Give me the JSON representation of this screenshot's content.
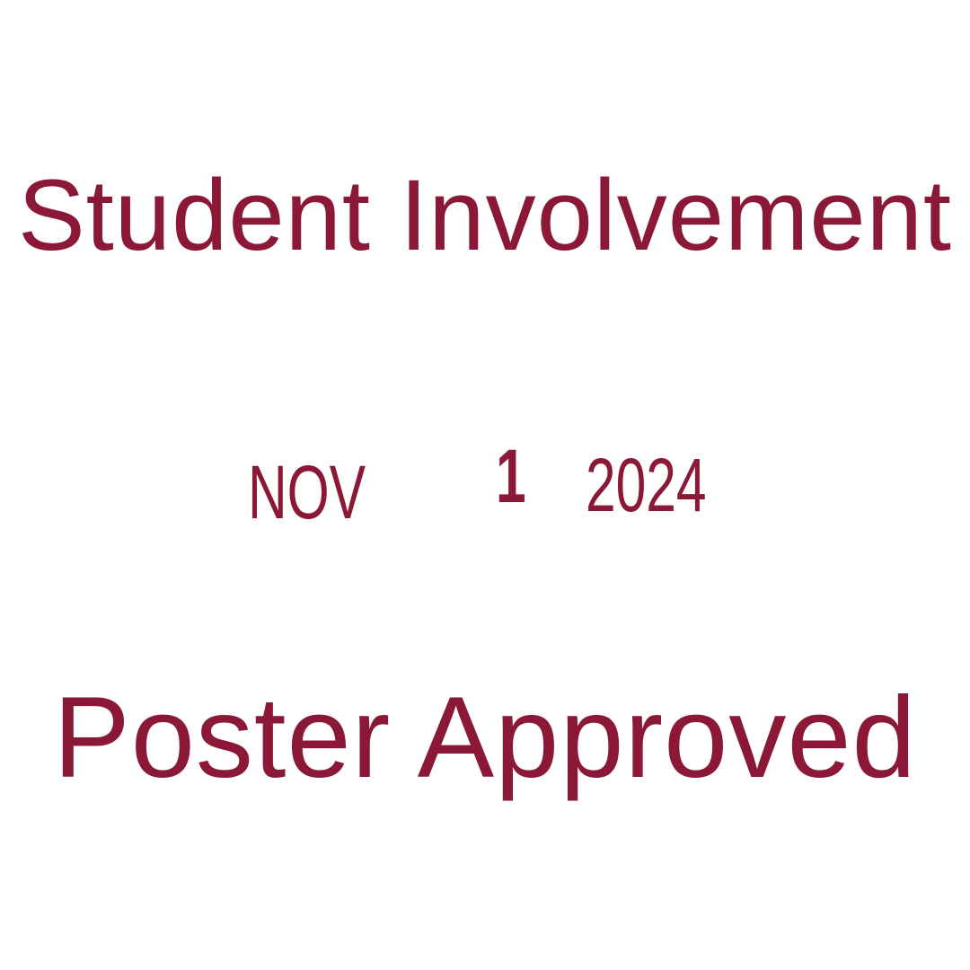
{
  "stamp": {
    "title": "Student Involvement",
    "date": {
      "month": "NOV",
      "day": "1",
      "year": "2024"
    },
    "subtitle": "Poster Approved",
    "ink_color": "#8a1836"
  }
}
